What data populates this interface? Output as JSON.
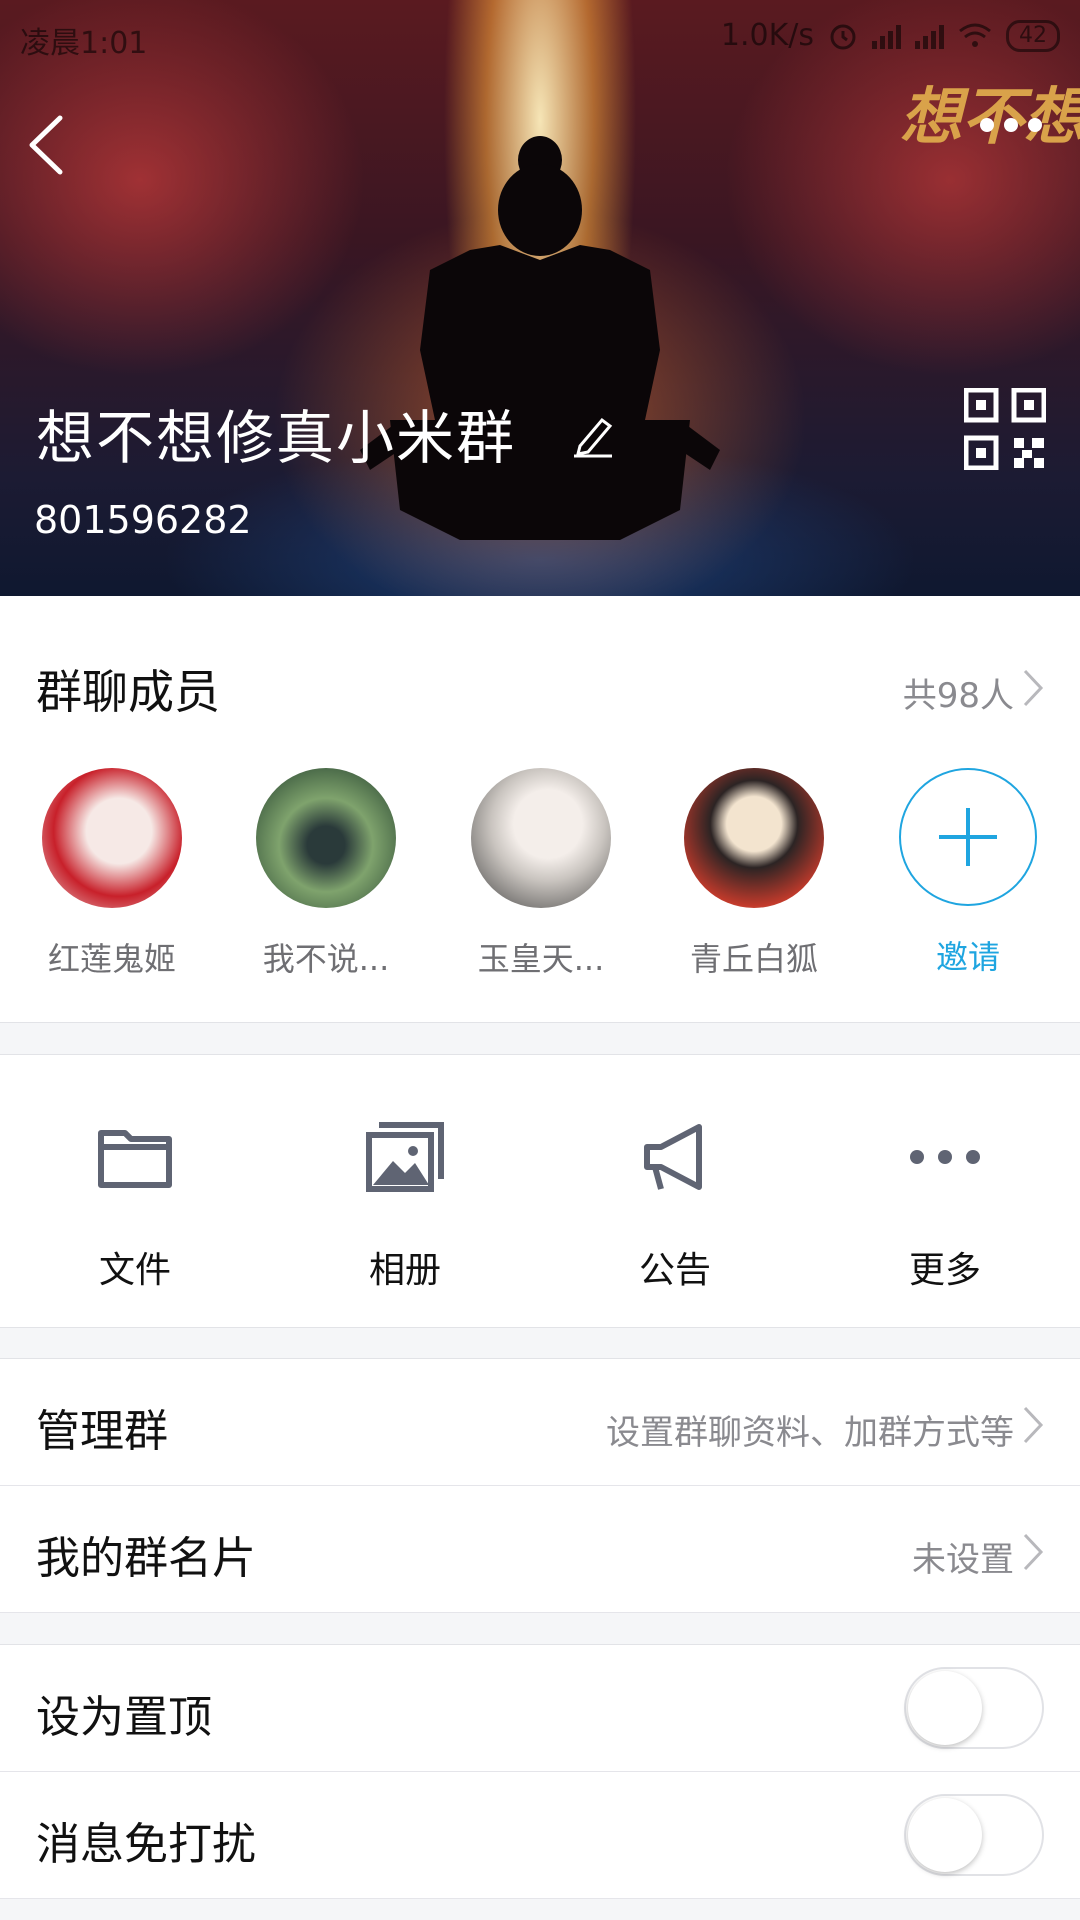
{
  "status_bar": {
    "time": "凌晨1:01",
    "network_speed": "1.0K/s",
    "battery": "42"
  },
  "header": {
    "group_name": "想不想修真小米群",
    "group_id": "801596282",
    "logo_text": "想不想修"
  },
  "members": {
    "title": "群聊成员",
    "count_label": "共98人",
    "list": [
      {
        "name": "红莲鬼姬",
        "color_a": "#f2e8e8",
        "color_b": "#c8202a"
      },
      {
        "name": "我不说...",
        "color_a": "#1e3a2a",
        "color_b": "#7fa36d"
      },
      {
        "name": "玉皇天...",
        "color_a": "#f1eeea",
        "color_b": "#3b3b3b"
      },
      {
        "name": "青丘白狐",
        "color_a": "#f3e4cf",
        "color_b": "#c23a2b"
      }
    ],
    "invite_label": "邀请"
  },
  "shortcuts": [
    {
      "label": "文件",
      "icon": "folder-icon"
    },
    {
      "label": "相册",
      "icon": "album-icon"
    },
    {
      "label": "公告",
      "icon": "megaphone-icon"
    },
    {
      "label": "更多",
      "icon": "more-dots-icon"
    }
  ],
  "settings": {
    "manage": {
      "label": "管理群",
      "value": "设置群聊资料、加群方式等"
    },
    "card": {
      "label": "我的群名片",
      "value": "未设置"
    },
    "pin": {
      "label": "设为置顶",
      "on": false
    },
    "mute": {
      "label": "消息免打扰",
      "on": false
    }
  },
  "colors": {
    "accent": "#1fa5e0",
    "icon_gray": "#5f6473",
    "secondary_text": "#8a8a8f"
  }
}
